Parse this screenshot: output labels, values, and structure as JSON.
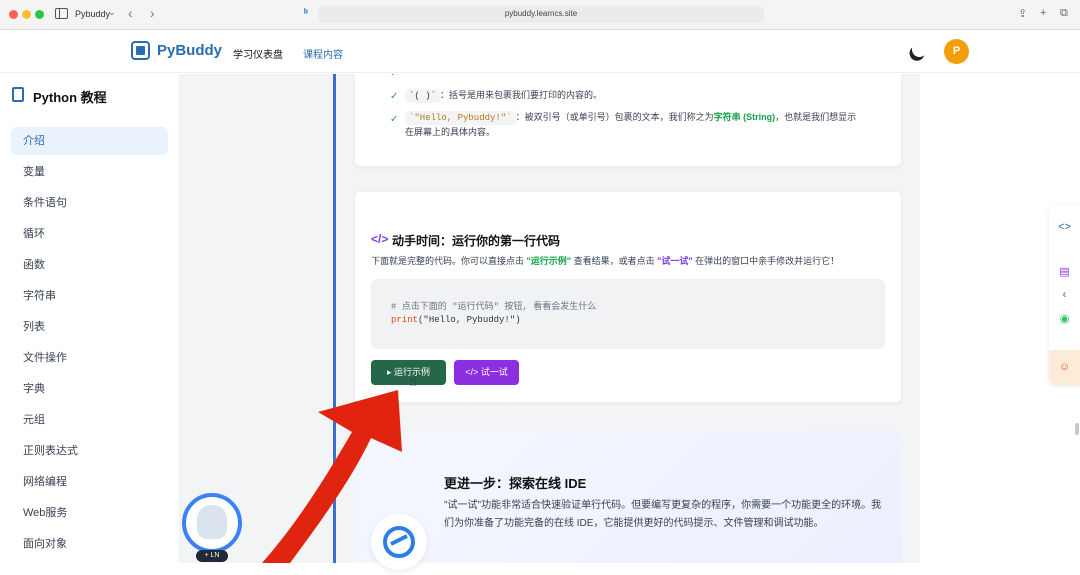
{
  "browser": {
    "tab_name": "Pybuddy",
    "address": "pybuddy.learncs.site"
  },
  "header": {
    "brand": "PyBuddy",
    "nav": [
      {
        "label": "学习仪表盘"
      },
      {
        "label": "课程内容"
      }
    ],
    "avatar_letter": "P",
    "avatar_color": "#f59e0b"
  },
  "sidebar": {
    "title": "Python 教程",
    "items": [
      {
        "label": "介绍"
      },
      {
        "label": "变量"
      },
      {
        "label": "条件语句"
      },
      {
        "label": "循环"
      },
      {
        "label": "函数"
      },
      {
        "label": "字符串"
      },
      {
        "label": "列表"
      },
      {
        "label": "文件操作"
      },
      {
        "label": "字典"
      },
      {
        "label": "元组"
      },
      {
        "label": "正则表达式"
      },
      {
        "label": "网络编程"
      },
      {
        "label": "Web服务"
      },
      {
        "label": "面向对象"
      }
    ]
  },
  "explain": {
    "item1_code": "`( )`",
    "item1_text": "：括号是用来包裹我们要打印的内容的。",
    "item2_code": "`\"Hello, Pybuddy!\"`",
    "item2_text_a": "：被双引号（或单引号）包裹的文本，我们称之为",
    "item2_highlight": "字符串 (String)",
    "item2_text_b": "，也就是我们想显示",
    "item2_text_c": "在屏幕上的具体内容。"
  },
  "handson": {
    "title": "动手时间：运行你的第一行代码",
    "desc_a": "下面就是完整的代码。你可以直接点击 ",
    "desc_run": "\"运行示例\"",
    "desc_b": " 查看结果，或者点击 ",
    "desc_try": "\"试一试\"",
    "desc_c": " 在弹出的窗口中亲手修改并运行它！",
    "code_comment": "# 点击下面的 \"运行代码\" 按钮, 看看会发生什么",
    "code_fn": "print",
    "code_args": "(\"Hello, Pybuddy!\")",
    "run_label": "运行示例",
    "try_label": "试一试"
  },
  "ide": {
    "title": "更进一步：探索在线 IDE",
    "text": "\"试一试\"功能非常适合快速验证单行代码。但要编写更复杂的程序，你需要一个功能更全的环境。我们为你准备了功能完备的在线 IDE，它能提供更好的代码提示、文件管理和调试功能。"
  },
  "mascot": {
    "badge": "+ LN"
  },
  "colors": {
    "accent": "#2b6cb0",
    "run_button": "#276749",
    "try_button": "#8b2fe0",
    "arrow": "#e0240f"
  }
}
